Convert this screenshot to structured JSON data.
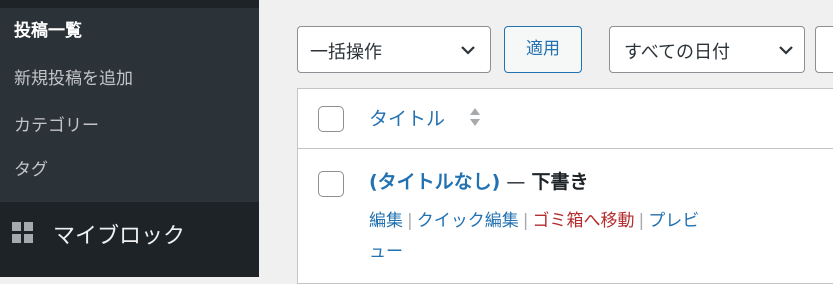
{
  "sidebar": {
    "submenu": [
      {
        "label": "投稿一覧",
        "current": true
      },
      {
        "label": "新規投稿を追加",
        "current": false
      },
      {
        "label": "カテゴリー",
        "current": false
      },
      {
        "label": "タグ",
        "current": false
      }
    ],
    "main_item": {
      "label": "マイブロック",
      "icon": "grid-icon"
    }
  },
  "toolbar": {
    "bulk_action_value": "一括操作",
    "apply_label": "適用",
    "date_filter_value": "すべての日付"
  },
  "table": {
    "header": {
      "title_column": "タイトル"
    },
    "rows": [
      {
        "title": "(タイトルなし)",
        "separator": " — ",
        "state": "下書き",
        "actions": {
          "edit": "編集",
          "quick_edit": "クイック編集",
          "trash": "ゴミ箱へ移動",
          "preview_part1": "プレビ",
          "preview_part2": "ュー"
        },
        "action_separator": "|"
      }
    ]
  },
  "colors": {
    "sidebar_bg": "#2c3338",
    "sidebar_dark": "#1d2327",
    "link": "#2271b1",
    "trash": "#b32d2e",
    "content_bg": "#f0f0f1"
  }
}
